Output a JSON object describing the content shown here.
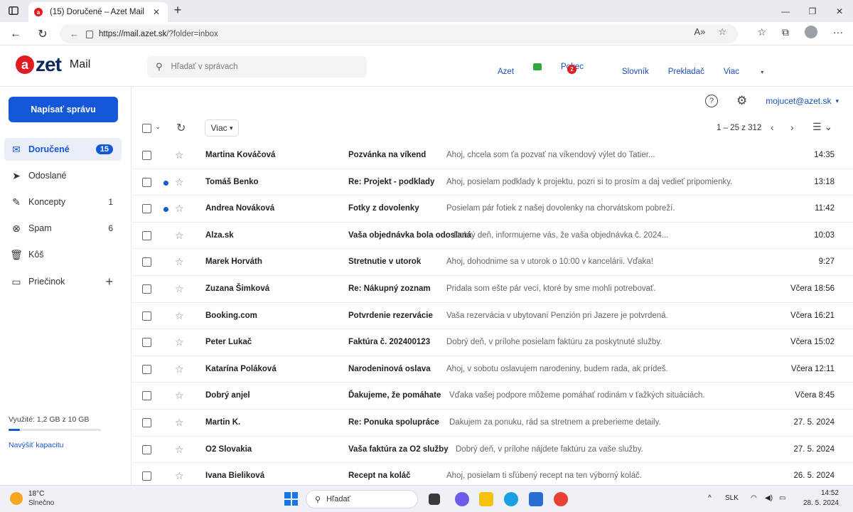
{
  "browser": {
    "tab_title": "(15) Doručené – Azet Mail",
    "url_host": "https://mail.azet.sk",
    "url_path": "/?folder=inbox"
  },
  "header": {
    "logo_text": "zet",
    "app_name": "Mail",
    "search_placeholder": "Hľadať v správach",
    "nav": {
      "azet": "Azet",
      "pokec": "Pokec",
      "pokec_badge": "2",
      "slovnik": "Slovník",
      "prekladac": "Prekladač",
      "viac": "Viac"
    }
  },
  "sidebar": {
    "compose_label": "Napísať správu",
    "items": [
      {
        "label": "Doručené",
        "count": "15",
        "icon": "inbox-icon"
      },
      {
        "label": "Odoslané",
        "count": "",
        "icon": "send-icon"
      },
      {
        "label": "Koncepty",
        "count": "1",
        "icon": "draft-icon"
      },
      {
        "label": "Spam",
        "count": "6",
        "icon": "spam-icon"
      },
      {
        "label": "Kôš",
        "count": "",
        "icon": "trash-icon"
      },
      {
        "label": "Priečinok",
        "count": "",
        "icon": "folder-icon"
      }
    ],
    "usage_text": "Využité: 1,2 GB z 10 GB",
    "usage_fraction": 0.12,
    "upgrade_link": "Navýšiť kapacitu"
  },
  "main": {
    "account": "mojucet@azet.sk",
    "viac_label": "Viac",
    "pager": "1 – 25 z 312",
    "accent_color": "#1458d7"
  },
  "emails": [
    {
      "from": "Martina Kováčová",
      "subject": "Pozvánka na víkend",
      "preview": "Ahoj, chcela som ťa pozvať na víkendový výlet do Tatier...",
      "time": "14:35",
      "unread": false
    },
    {
      "from": "Tomáš Benko",
      "subject": "Re: Projekt - podklady",
      "preview": "Ahoj, posielam podklady k projektu, pozri si to prosím a daj vedieť pripomienky.",
      "time": "13:18",
      "unread": true
    },
    {
      "from": "Andrea Nováková",
      "subject": "Fotky z dovolenky",
      "preview": "Posielam pár fotiek z našej dovolenky na chorvátskom pobreží.",
      "time": "11:42",
      "unread": true
    },
    {
      "from": "Alza.sk",
      "subject": "Vaša objednávka bola odoslaná",
      "preview": "Dobrý deň, informujeme vás, že vaša objednávka č. 2024...",
      "time": "10:03",
      "unread": false
    },
    {
      "from": "Marek Horváth",
      "subject": "Stretnutie v utorok",
      "preview": "Ahoj, dohodnime sa v utorok o 10:00 v kancelárii. Vďaka!",
      "time": "9:27",
      "unread": false
    },
    {
      "from": "Zuzana Šimková",
      "subject": "Re: Nákupný zoznam",
      "preview": "Pridala som ešte pár vecí, ktoré by sme mohli potrebovať.",
      "time": "Včera 18:56",
      "unread": false
    },
    {
      "from": "Booking.com",
      "subject": "Potvrdenie rezervácie",
      "preview": "Vaša rezervácia v ubytovaní Penzión pri Jazere je potvrdená.",
      "time": "Včera 16:21",
      "unread": false
    },
    {
      "from": "Peter Lukač",
      "subject": "Faktúra č. 202400123",
      "preview": "Dobrý deň, v prílohe posielam faktúru za poskytnuté služby.",
      "time": "Včera 15:02",
      "unread": false
    },
    {
      "from": "Katarína Poláková",
      "subject": "Narodeninová oslava",
      "preview": "Ahoj, v sobotu oslavujem narodeniny, budem rada, ak prídeš.",
      "time": "Včera 12:11",
      "unread": false
    },
    {
      "from": "Dobrý anjel",
      "subject": "Ďakujeme, že pomáhate",
      "preview": "Vďaka vašej podpore môžeme pomáhať rodinám v ťažkých situáciách.",
      "time": "Včera 8:45",
      "unread": false
    },
    {
      "from": "Martin K.",
      "subject": "Re: Ponuka spolupráce",
      "preview": "Ďakujem za ponuku, rád sa stretnem a preberieme detaily.",
      "time": "27. 5. 2024",
      "unread": false
    },
    {
      "from": "O2 Slovakia",
      "subject": "Vaša faktúra za O2 služby",
      "preview": "Dobrý deň, v prílohe nájdete faktúru za vaše služby.",
      "time": "27. 5. 2024",
      "unread": false
    },
    {
      "from": "Ivana Bieliková",
      "subject": "Recept na koláč",
      "preview": "Ahoj, posielam ti sľúbený recept na ten výborný koláč.",
      "time": "26. 5. 2024",
      "unread": false
    }
  ],
  "taskbar": {
    "temp": "18°C",
    "weather": "Slnečno",
    "search_label": "Hľadať",
    "lang": "SLK",
    "time": "14:52",
    "date": "28. 5. 2024"
  }
}
